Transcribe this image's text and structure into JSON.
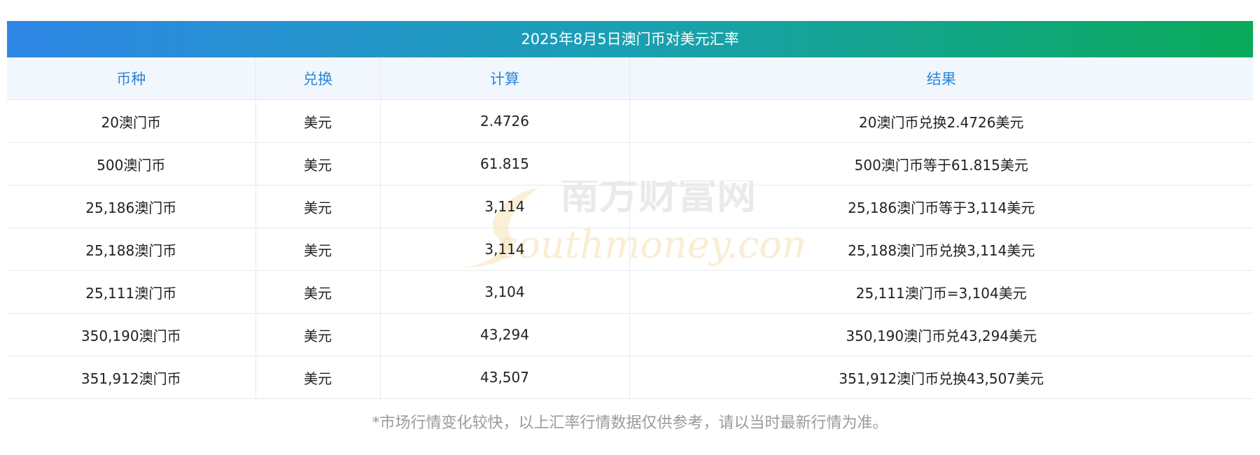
{
  "table": {
    "title": "2025年8月5日澳门币对美元汇率",
    "headers": [
      "币种",
      "兑换",
      "计算",
      "结果"
    ],
    "rows": [
      {
        "currency": "20澳门币",
        "target": "美元",
        "calc": "2.4726",
        "result": "20澳门币兑换2.4726美元"
      },
      {
        "currency": "500澳门币",
        "target": "美元",
        "calc": "61.815",
        "result": "500澳门币等于61.815美元"
      },
      {
        "currency": "25,186澳门币",
        "target": "美元",
        "calc": "3,114",
        "result": "25,186澳门币等于3,114美元"
      },
      {
        "currency": "25,188澳门币",
        "target": "美元",
        "calc": "3,114",
        "result": "25,188澳门币兑换3,114美元"
      },
      {
        "currency": "25,111澳门币",
        "target": "美元",
        "calc": "3,104",
        "result": "25,111澳门币=3,104美元"
      },
      {
        "currency": "350,190澳门币",
        "target": "美元",
        "calc": "43,294",
        "result": "350,190澳门币兑43,294美元"
      },
      {
        "currency": "351,912澳门币",
        "target": "美元",
        "calc": "43,507",
        "result": "351,912澳门币兑换43,507美元"
      }
    ]
  },
  "watermark": {
    "cn": "南方财富网",
    "en": "southmoney.com",
    "color_cn": "#d9d9d9",
    "color_en": "#f6dfae"
  },
  "footnote": "*市场行情变化较快，以上汇率行情数据仅供参考，请以当时最新行情为准。"
}
